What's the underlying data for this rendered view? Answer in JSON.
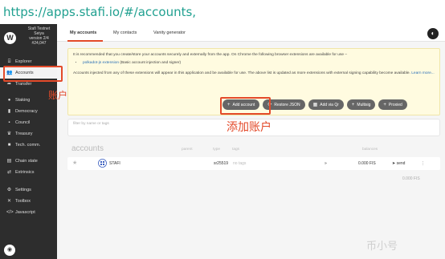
{
  "url": "https://apps.stafi.io/#/accounts,",
  "brand": {
    "name": "Stafi Testnet",
    "line2": "Seiya",
    "version": "version 2/4",
    "block": "#24,047"
  },
  "sidebar": {
    "items": [
      {
        "label": "Explorer",
        "icon": "explorer-icon",
        "glyph": "⌸"
      },
      {
        "label": "Accounts",
        "icon": "accounts-icon",
        "glyph": "👥",
        "active": true
      },
      {
        "label": "Transfer",
        "icon": "transfer-icon",
        "glyph": "➦"
      },
      {
        "label": "Staking",
        "icon": "staking-icon",
        "glyph": "●"
      },
      {
        "label": "Democracy",
        "icon": "democracy-icon",
        "glyph": "▮"
      },
      {
        "label": "Council",
        "icon": "council-icon",
        "glyph": "▪"
      },
      {
        "label": "Treasury",
        "icon": "treasury-icon",
        "glyph": "♛"
      },
      {
        "label": "Tech. comm.",
        "icon": "tech-comm-icon",
        "glyph": "■"
      },
      {
        "label": "Chain state",
        "icon": "chain-state-icon",
        "glyph": "▤"
      },
      {
        "label": "Extrinsics",
        "icon": "extrinsics-icon",
        "glyph": "⇄"
      },
      {
        "label": "Settings",
        "icon": "settings-icon",
        "glyph": "⚙"
      },
      {
        "label": "Toolbox",
        "icon": "toolbox-icon",
        "glyph": "✕"
      },
      {
        "label": "Javascript",
        "icon": "javascript-icon",
        "glyph": "</>"
      }
    ]
  },
  "annotations": {
    "accounts": "账户",
    "add_account": "添加账户"
  },
  "tabs": [
    {
      "label": "My accounts",
      "active": true
    },
    {
      "label": "My contacts"
    },
    {
      "label": "Vanity generator"
    }
  ],
  "notice": {
    "para1": "It is recommended that you create/store your accounts securely and externally from the app. On Chrome the following browser extensions are available for use –",
    "ext_link": "polkadot-js extension",
    "ext_desc": "(Basic account injection and signer)",
    "para2": "Accounts injected from any of these extensions will appear in this application and be available for use. The above list is updated as more extensions with external signing capability become available.",
    "learn_more": "Learn more..."
  },
  "actions": [
    {
      "label": "Add account",
      "icon": "plus-icon",
      "glyph": "+"
    },
    {
      "label": "Restore JSON",
      "icon": "sync-icon",
      "glyph": "⟳"
    },
    {
      "label": "Add via Qr",
      "icon": "qr-icon",
      "glyph": "▦"
    },
    {
      "label": "Multisig",
      "icon": "plus-icon",
      "glyph": "+"
    },
    {
      "label": "Proxied",
      "icon": "plus-icon",
      "glyph": "+"
    }
  ],
  "filter": {
    "label": "filter by name or tags"
  },
  "table": {
    "title": "accounts",
    "columns": [
      "parent",
      "type",
      "tags",
      "balances"
    ],
    "rows": [
      {
        "name": "STAFI",
        "type": "sr25519",
        "tags": "no tags",
        "balance": "0.000 FIS",
        "send": "send"
      }
    ],
    "total": "0.000 FIS"
  },
  "watermark": "币小号",
  "colors": {
    "accent": "#e34a2a",
    "sidebar_bg": "#2d2d2d",
    "url": "#20a090",
    "button": "#666666",
    "notice_bg": "#fffbe0"
  }
}
